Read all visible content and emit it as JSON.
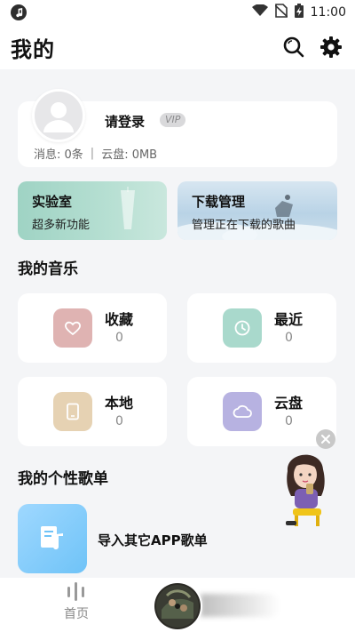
{
  "status_bar": {
    "time": "11:00"
  },
  "header": {
    "title": "我的"
  },
  "profile": {
    "login_text": "请登录",
    "vip_label": "VIP",
    "messages_text": "消息: 0条",
    "separator": "|",
    "cloud_text": "云盘: 0MB"
  },
  "tiles": {
    "lab": {
      "title": "实验室",
      "subtitle": "超多新功能"
    },
    "download": {
      "title": "下载管理",
      "subtitle": "管理正在下载的歌曲"
    }
  },
  "my_music": {
    "section_title": "我的音乐",
    "items": [
      {
        "label": "收藏",
        "count": "0",
        "icon": "heart-icon",
        "color": "#dfb3b2"
      },
      {
        "label": "最近",
        "count": "0",
        "icon": "clock-icon",
        "color": "#a9d9cc"
      },
      {
        "label": "本地",
        "count": "0",
        "icon": "phone-icon",
        "color": "#e6d2b3"
      },
      {
        "label": "云盘",
        "count": "0",
        "icon": "cloud-icon",
        "color": "#b7b2e1"
      }
    ]
  },
  "playlists": {
    "section_title": "我的个性歌单",
    "import_label": "导入其它APP歌单"
  },
  "bottom_nav": {
    "home_label": "首页"
  },
  "colors": {
    "background": "#f4f5f7",
    "card": "#ffffff",
    "lab_tile": "#9fd3c4",
    "download_tile": "#c5dbea",
    "import_icon": "#7cc9f9"
  }
}
